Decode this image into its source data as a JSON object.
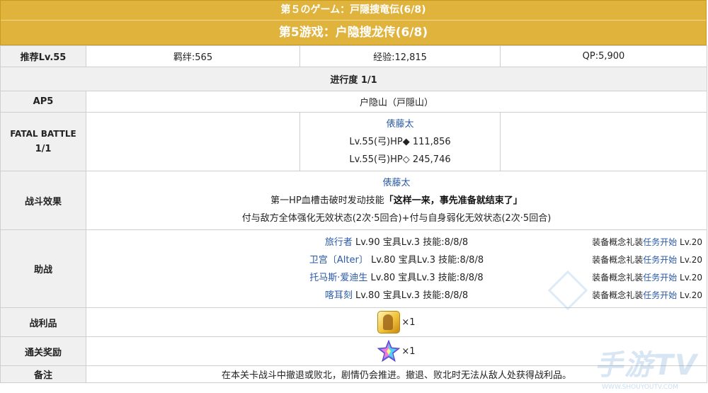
{
  "banner": {
    "title_jp": "第５のゲーム：戸隠捜竜伝(6/8)",
    "title_cn": "第5游戏：户隐搜龙传(6/8)"
  },
  "info": {
    "recommend": "推荐Lv.55",
    "bond": "羁绊:565",
    "exp": "经验:12,815",
    "qp": "QP:5,900"
  },
  "progress": "进行度 1/1",
  "ap": {
    "label": "AP5",
    "location": "户隐山（戸隠山）"
  },
  "fatal": {
    "label_line1": "FATAL BATTLE",
    "label_line2": "1/1",
    "enemy_name": "俵藤太",
    "hp_lines": [
      "Lv.55(弓)HP◆ 111,856",
      "Lv.55(弓)HP◇ 245,746"
    ]
  },
  "effect": {
    "label": "战斗效果",
    "enemy_name": "俵藤太",
    "line1_prefix": "第一HP血槽击破时发动技能",
    "line1_skill": "「这样一来，事先准备就结束了」",
    "line2": "付与敌方全体强化无效状态(2次·5回合)+付与自身弱化无效状态(2次·5回合)"
  },
  "support": {
    "label": "助战",
    "rows": [
      {
        "name": "旅行者",
        "stats": " Lv.90 宝具Lv.3 技能:8/8/8",
        "eq_prefix": "装备概念礼装",
        "eq_name": "任务开始",
        "eq_lv": " Lv.20"
      },
      {
        "name": "卫宫〔Alter〕",
        "stats": " Lv.80 宝具Lv.3 技能:8/8/8",
        "eq_prefix": "装备概念礼装",
        "eq_name": "任务开始",
        "eq_lv": " Lv.20"
      },
      {
        "name": "托马斯·爱迪生",
        "stats": " Lv.80 宝具Lv.3 技能:8/8/8",
        "eq_prefix": "装备概念礼装",
        "eq_name": "任务开始",
        "eq_lv": " Lv.20"
      },
      {
        "name": "喀耳刻",
        "stats": " Lv.80 宝具Lv.3 技能:8/8/8",
        "eq_prefix": "装备概念礼装",
        "eq_name": "任务开始",
        "eq_lv": " Lv.20"
      }
    ]
  },
  "drops": {
    "label": "战利品",
    "item_icon": "gold-statue-icon",
    "count": "×1"
  },
  "reward": {
    "label": "通关奖励",
    "item_icon": "saint-quartz-icon",
    "count": "×1"
  },
  "notes": {
    "label": "备注",
    "text": "在本关卡战斗中撤退或败北，剧情仍会推进。撤退、败北时无法从敌人处获得战利品。"
  },
  "watermark": {
    "main": "手游TV",
    "sub": "WWW.SHOUYOUTV.COM"
  },
  "colors": {
    "banner": "#e0b33d",
    "label_bg": "#f0f0f0",
    "link_blue": "#2a5aa8",
    "border": "#cfcfcf"
  }
}
